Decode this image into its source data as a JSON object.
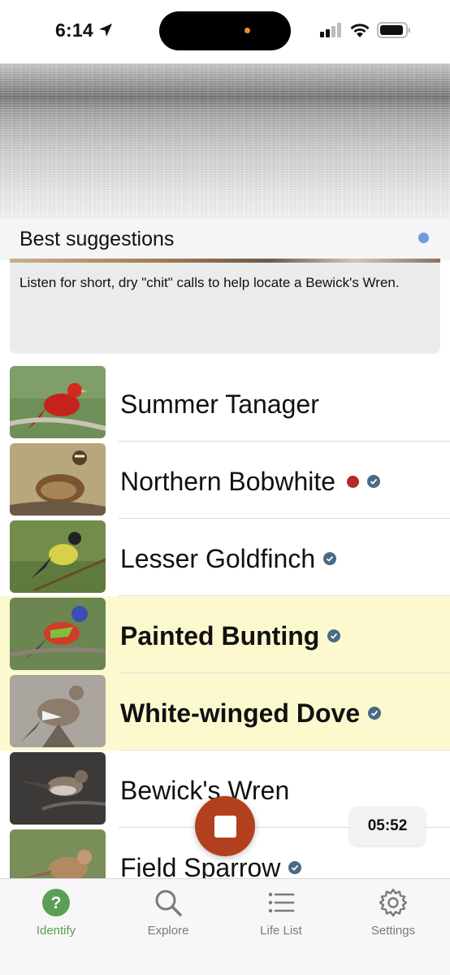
{
  "status_bar": {
    "time": "6:14",
    "icons": [
      "location-arrow-icon",
      "cellular-signal-icon",
      "wifi-icon",
      "battery-icon"
    ]
  },
  "suggestions": {
    "title": "Best suggestions",
    "tip": "Listen for short, dry \"chit\" calls to help locate a Bewick's Wren.",
    "accent_dot_color": "#6f9ce0"
  },
  "species": [
    {
      "name": "Summer Tanager",
      "highlighted": false,
      "verified": false,
      "red_dot": false
    },
    {
      "name": "Northern Bobwhite",
      "highlighted": false,
      "verified": true,
      "red_dot": true
    },
    {
      "name": "Lesser Goldfinch",
      "highlighted": false,
      "verified": true,
      "red_dot": false
    },
    {
      "name": "Painted Bunting",
      "highlighted": true,
      "verified": true,
      "red_dot": false
    },
    {
      "name": "White-winged Dove",
      "highlighted": true,
      "verified": true,
      "red_dot": false
    },
    {
      "name": "Bewick's Wren",
      "highlighted": false,
      "verified": false,
      "red_dot": false
    },
    {
      "name": "Field Sparrow",
      "highlighted": false,
      "verified": true,
      "red_dot": false
    }
  ],
  "recording": {
    "timer": "05:52",
    "button_color": "#b23f1e"
  },
  "tabs": [
    {
      "label": "Identify",
      "icon": "question-circle-icon",
      "active": true
    },
    {
      "label": "Explore",
      "icon": "search-icon",
      "active": false
    },
    {
      "label": "Life List",
      "icon": "list-icon",
      "active": false
    },
    {
      "label": "Settings",
      "icon": "gear-icon",
      "active": false
    }
  ],
  "colors": {
    "highlight_row": "#fdf9cf",
    "active_tab": "#5b9e54",
    "verified_check": "#4a6a85"
  }
}
